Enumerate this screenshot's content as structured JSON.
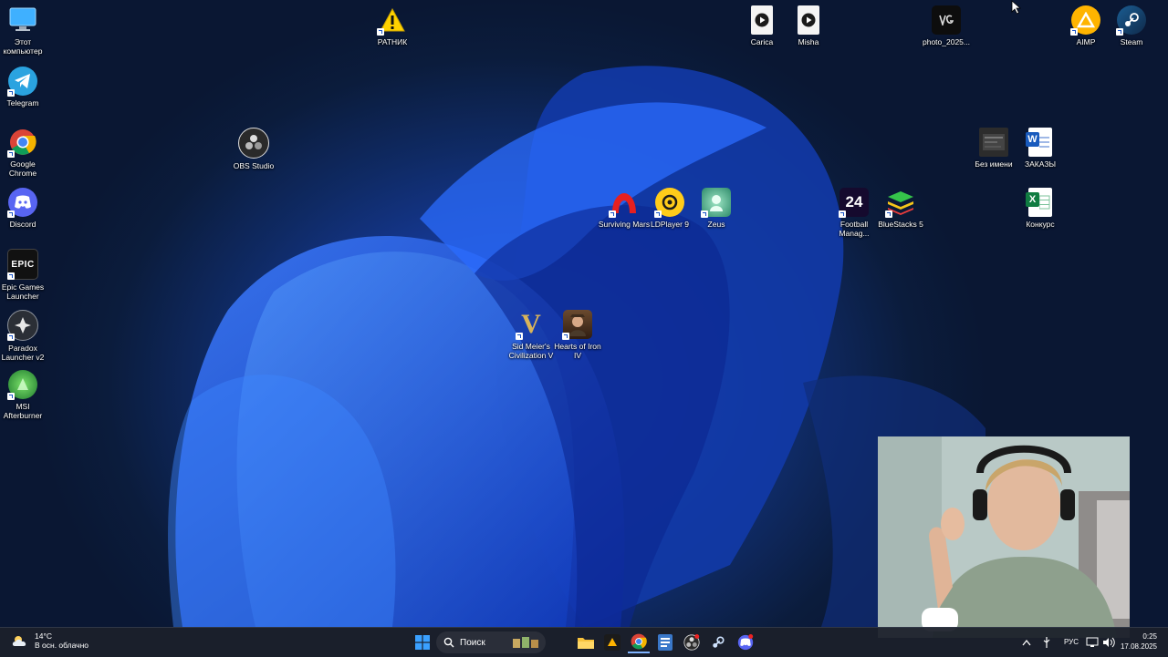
{
  "desktop": {
    "icons": [
      {
        "label": "Этот компьютер",
        "icon": "monitor-icon"
      },
      {
        "label": "Telegram",
        "icon": "telegram-icon"
      },
      {
        "label": "Google Chrome",
        "icon": "chrome-icon"
      },
      {
        "label": "Discord",
        "icon": "discord-icon"
      },
      {
        "label": "Epic Games Launcher",
        "icon": "epic-games-icon",
        "logo_text": "EPIC"
      },
      {
        "label": "Paradox Launcher v2",
        "icon": "paradox-icon"
      },
      {
        "label": "MSI Afterburner",
        "icon": "msi-afterburner-icon"
      },
      {
        "label": "OBS Studio",
        "icon": "obs-icon"
      },
      {
        "label": "РАТНИК",
        "icon": "warning-icon"
      },
      {
        "label": "Carica",
        "icon": "video-file-icon"
      },
      {
        "label": "Misha",
        "icon": "video-file-icon"
      },
      {
        "label": "photo_2025...",
        "icon": "image-file-icon"
      },
      {
        "label": "AIMP",
        "icon": "aimp-icon"
      },
      {
        "label": "Steam",
        "icon": "steam-icon"
      },
      {
        "label": "Без имени",
        "icon": "image-file-icon"
      },
      {
        "label": "ЗАКАЗЫ",
        "icon": "word-document-icon",
        "logo_text": "W"
      },
      {
        "label": "Конкурс",
        "icon": "excel-document-icon",
        "logo_text": "X"
      },
      {
        "label": "Surviving Mars",
        "icon": "surviving-mars-icon"
      },
      {
        "label": "LDPlayer 9",
        "icon": "ldplayer-icon"
      },
      {
        "label": "Zeus",
        "icon": "zeus-icon"
      },
      {
        "label": "Football Manag...",
        "icon": "football-manager-icon",
        "logo_text": "24"
      },
      {
        "label": "BlueStacks 5",
        "icon": "bluestacks-icon"
      },
      {
        "label": "Sid Meier's Civilization V",
        "icon": "civilization-icon",
        "logo_text": "V"
      },
      {
        "label": "Hearts of Iron IV",
        "icon": "hearts-of-iron-icon"
      }
    ]
  },
  "taskbar": {
    "weather": {
      "temperature": "14°C",
      "condition": "В осн. облачно"
    },
    "search_placeholder": "Поиск",
    "apps": [
      "start-icon",
      "search-icon",
      "widgets-icon",
      "file-explorer-icon",
      "pinned-app-icon",
      "chrome-icon",
      "notepad-icon",
      "obs-icon",
      "steam-icon",
      "discord-icon"
    ],
    "tray": {
      "language": "РУС",
      "time": "0:25",
      "date": "17.08.2025"
    }
  },
  "colors": {
    "taskbar_bg": "#1c202a",
    "wallpaper_blue": "#1f49c9",
    "accent": "#0a64d8"
  }
}
